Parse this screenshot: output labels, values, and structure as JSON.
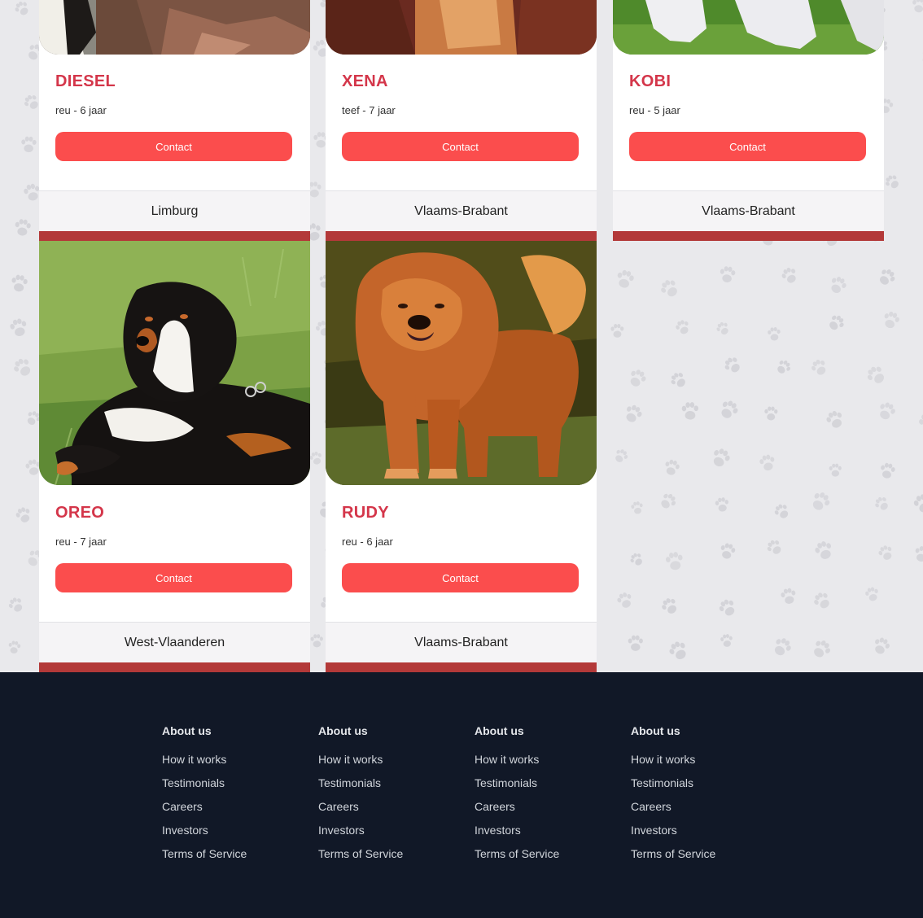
{
  "dogs": [
    {
      "name": "DIESEL",
      "meta": "reu - 6 jaar",
      "contact": "Contact",
      "region": "Limburg"
    },
    {
      "name": "XENA",
      "meta": "teef - 7 jaar",
      "contact": "Contact",
      "region": "Vlaams-Brabant"
    },
    {
      "name": "KOBI",
      "meta": "reu - 5 jaar",
      "contact": "Contact",
      "region": "Vlaams-Brabant"
    },
    {
      "name": "OREO",
      "meta": "reu - 7 jaar",
      "contact": "Contact",
      "region": "West-Vlaanderen"
    },
    {
      "name": "RUDY",
      "meta": "reu - 6 jaar",
      "contact": "Contact",
      "region": "Vlaams-Brabant"
    }
  ],
  "footer": {
    "columns": [
      {
        "heading": "About us",
        "links": [
          "How it works",
          "Testimonials",
          "Careers",
          "Investors",
          "Terms of Service"
        ]
      },
      {
        "heading": "About us",
        "links": [
          "How it works",
          "Testimonials",
          "Careers",
          "Investors",
          "Terms of Service"
        ]
      },
      {
        "heading": "About us",
        "links": [
          "How it works",
          "Testimonials",
          "Careers",
          "Investors",
          "Terms of Service"
        ]
      },
      {
        "heading": "About us",
        "links": [
          "How it works",
          "Testimonials",
          "Careers",
          "Investors",
          "Terms of Service"
        ]
      }
    ]
  },
  "colors": {
    "accent_name": "#d4364a",
    "button": "#fb4d4d",
    "card_bar": "#b33939",
    "footer_bg": "#111827",
    "page_bg": "#e9e9ec"
  },
  "icons": {
    "background_pattern": "paw-print-icon"
  }
}
